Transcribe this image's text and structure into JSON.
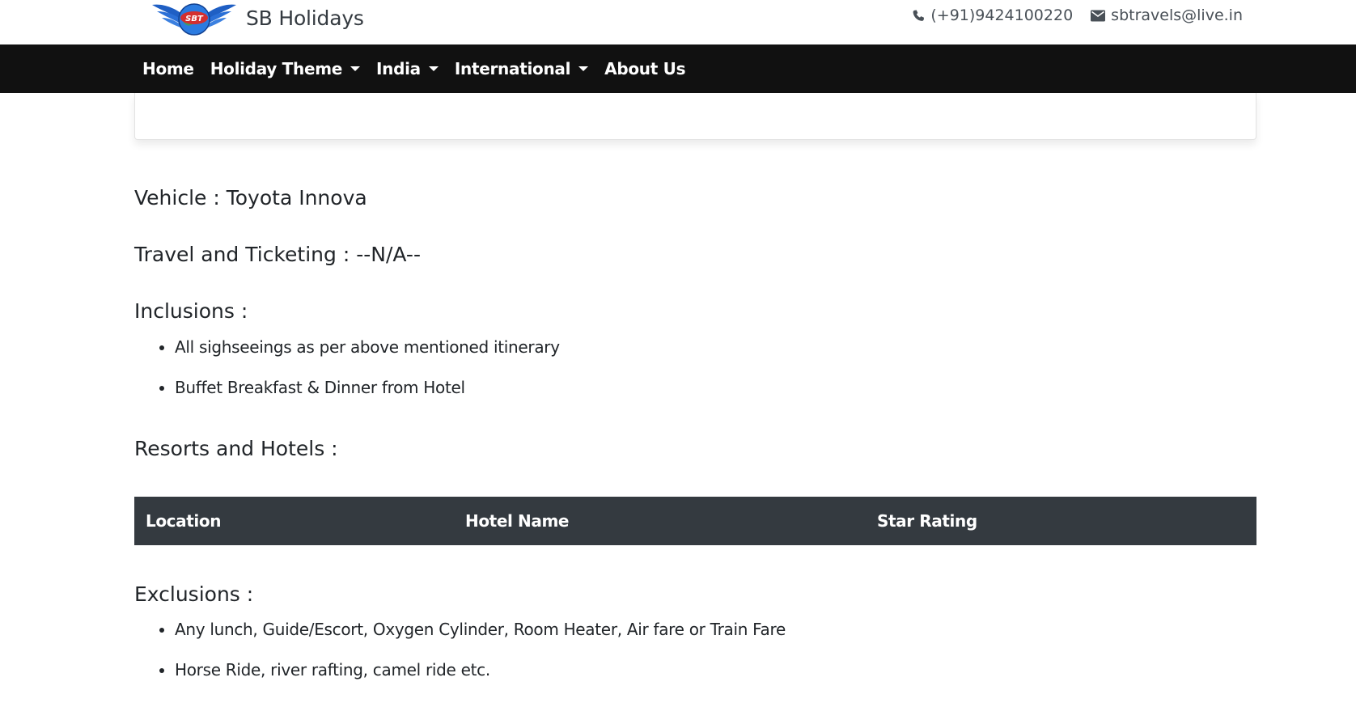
{
  "header": {
    "brand_name": "SB Holidays",
    "logo_text": "SBT",
    "phone": "(+91)9424100220",
    "email": "sbtravels@live.in"
  },
  "nav": {
    "items": [
      {
        "label": "Home",
        "dropdown": false
      },
      {
        "label": "Holiday Theme",
        "dropdown": true
      },
      {
        "label": "India",
        "dropdown": true
      },
      {
        "label": "International",
        "dropdown": true
      },
      {
        "label": "About Us",
        "dropdown": false
      }
    ]
  },
  "details": {
    "vehicle_label": "Vehicle :",
    "vehicle_value": "Toyota Innova",
    "travel_label": "Travel and Ticketing :",
    "travel_value": "--N/A--"
  },
  "inclusions": {
    "heading": "Inclusions :",
    "items": [
      "All sighseeings as per above mentioned itinerary",
      "Buffet Breakfast & Dinner from Hotel"
    ]
  },
  "hotels": {
    "heading": "Resorts and Hotels :",
    "columns": [
      "Location",
      "Hotel Name",
      "Star Rating"
    ]
  },
  "exclusions": {
    "heading": "Exclusions :",
    "items": [
      "Any lunch, Guide/Escort, Oxygen Cylinder, Room Heater, Air fare or Train Fare",
      "Horse Ride, river rafting, camel ride etc."
    ]
  },
  "colors": {
    "navbar_bg": "#111111",
    "table_header_bg": "#343a40",
    "logo_blue": "#1f5fc4",
    "logo_red": "#d32f2f"
  },
  "icons": {
    "phone": "phone-icon",
    "email": "envelope-icon",
    "logo": "winged-globe-logo"
  }
}
